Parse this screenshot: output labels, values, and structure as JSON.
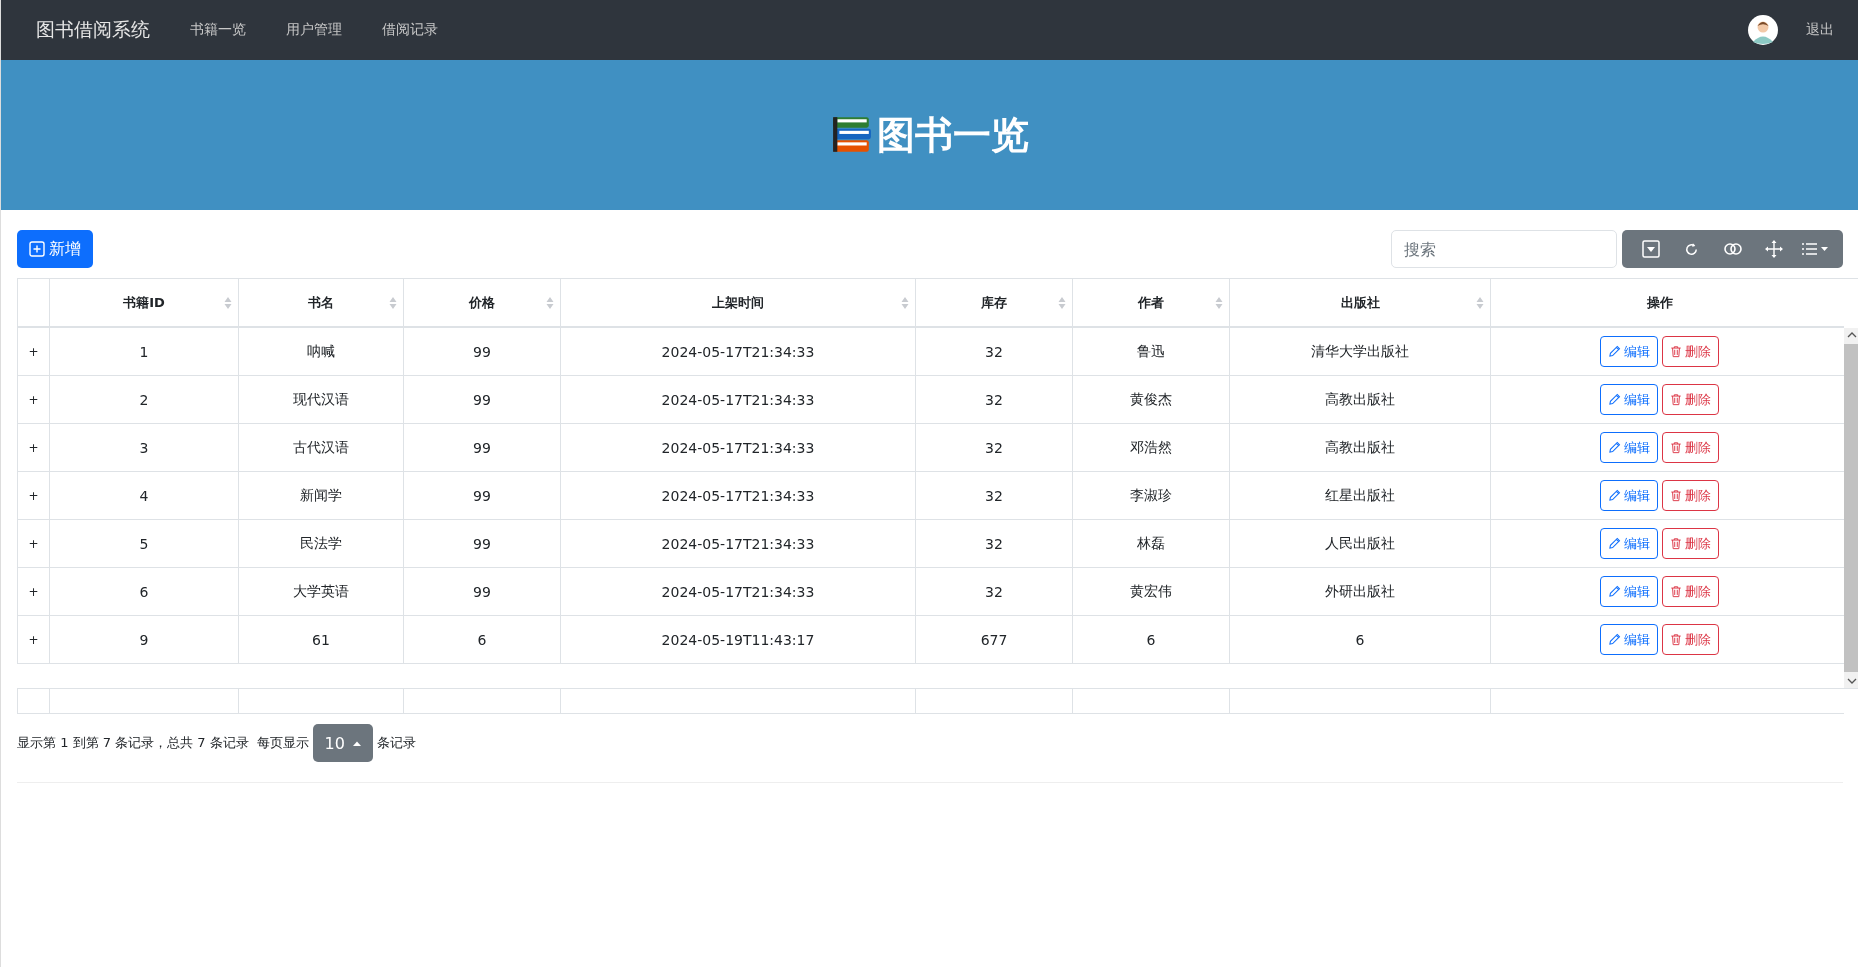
{
  "navbar": {
    "brand": "图书借阅系统",
    "items": [
      {
        "label": "书籍一览",
        "selected": false
      },
      {
        "label": "用户管理",
        "selected": false
      },
      {
        "label": "借阅记录",
        "selected": false
      }
    ],
    "logout": "退出"
  },
  "banner": {
    "title": "图书一览"
  },
  "toolbar": {
    "add_button": "新增",
    "search": {
      "placeholder": "搜索"
    }
  },
  "table": {
    "columns": [
      {
        "label": "书籍ID",
        "sortable": true
      },
      {
        "label": "书名",
        "sortable": true
      },
      {
        "label": "价格",
        "sortable": true
      },
      {
        "label": "上架时间",
        "sortable": true
      },
      {
        "label": "库存",
        "sortable": true
      },
      {
        "label": "作者",
        "sortable": true
      },
      {
        "label": "出版社",
        "sortable": true
      },
      {
        "label": "操作",
        "sortable": false
      }
    ],
    "rows": [
      {
        "expander": "+",
        "cells": [
          "1",
          "呐喊",
          "99",
          "2024-05-17T21:34:33",
          "32",
          "鲁迅",
          "清华大学出版社"
        ],
        "actions": [
          "编辑",
          "删除"
        ]
      },
      {
        "expander": "+",
        "cells": [
          "2",
          "现代汉语",
          "99",
          "2024-05-17T21:34:33",
          "32",
          "黄俊杰",
          "高教出版社"
        ],
        "actions": [
          "编辑",
          "删除"
        ]
      },
      {
        "expander": "+",
        "cells": [
          "3",
          "古代汉语",
          "99",
          "2024-05-17T21:34:33",
          "32",
          "邓浩然",
          "高教出版社"
        ],
        "actions": [
          "编辑",
          "删除"
        ]
      },
      {
        "expander": "+",
        "cells": [
          "4",
          "新闻学",
          "99",
          "2024-05-17T21:34:33",
          "32",
          "李淑珍",
          "红星出版社"
        ],
        "actions": [
          "编辑",
          "删除"
        ]
      },
      {
        "expander": "+",
        "cells": [
          "5",
          "民法学",
          "99",
          "2024-05-17T21:34:33",
          "32",
          "林磊",
          "人民出版社"
        ],
        "actions": [
          "编辑",
          "删除"
        ]
      },
      {
        "expander": "+",
        "cells": [
          "6",
          "大学英语",
          "99",
          "2024-05-17T21:34:33",
          "32",
          "黄宏伟",
          "外研出版社"
        ],
        "actions": [
          "编辑",
          "删除"
        ]
      },
      {
        "expander": "+",
        "cells": [
          "9",
          "61",
          "6",
          "2024-05-19T11:43:17",
          "677",
          "6",
          "6"
        ],
        "actions": [
          "编辑",
          "删除"
        ]
      }
    ]
  },
  "pagination": {
    "summary": "显示第 1 到第 7 条记录，总共 7 条记录",
    "per_page_label": "每页显示",
    "page_size": "10",
    "per_page_suffix": "条记录"
  }
}
